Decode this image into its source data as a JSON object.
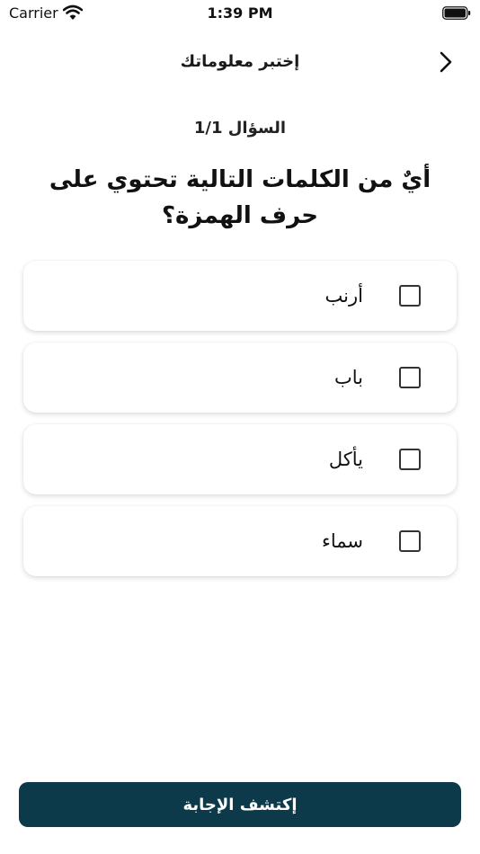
{
  "status_bar": {
    "carrier": "Carrier",
    "time": "1:39 PM"
  },
  "header": {
    "title": "إختبر معلوماتك"
  },
  "quiz": {
    "counter": "السؤال 1/1",
    "question": "أيٌ من الكلمات التالية تحتوي على حرف الهمزة؟",
    "options": [
      {
        "label": "أرنب",
        "checked": false
      },
      {
        "label": "باب",
        "checked": false
      },
      {
        "label": "يأكل",
        "checked": false
      },
      {
        "label": "سماء",
        "checked": false
      }
    ]
  },
  "footer": {
    "reveal_label": "إكتشف الإجابة"
  },
  "colors": {
    "primary": "#0c3a4b",
    "background": "#ffffff",
    "text": "#111111"
  }
}
